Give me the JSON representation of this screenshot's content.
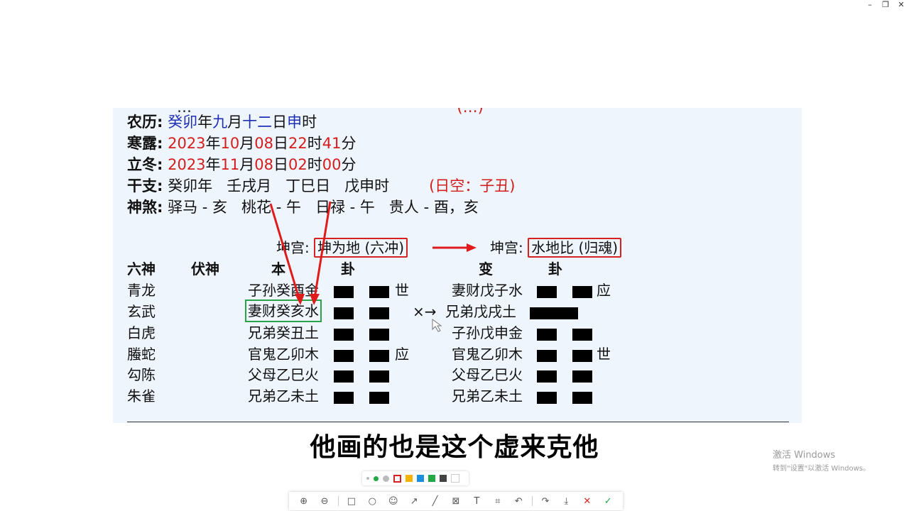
{
  "window": {
    "minimize": "–",
    "restore": "❐",
    "close": "✕"
  },
  "doc": {
    "cut_line": {
      "left": "…",
      "right": "(…)"
    },
    "lunar": {
      "label": "农历:",
      "year": "癸卯",
      "nian": "年",
      "month": "九",
      "yue": "月",
      "day": "十二",
      "ri": "日",
      "hour": "申",
      "shi": "时"
    },
    "hanlu": {
      "label": "寒露:",
      "y": "2023",
      "nian": "年",
      "m": "10",
      "yue": "月",
      "d": "08",
      "ri": "日",
      "h": "22",
      "shi": "时",
      "mi": "41",
      "fen": "分"
    },
    "lidong": {
      "label": "立冬:",
      "y": "2023",
      "nian": "年",
      "m": "11",
      "yue": "月",
      "d": "08",
      "ri": "日",
      "h": "02",
      "shi": "时",
      "mi": "00",
      "fen": "分"
    },
    "ganzhi": {
      "label": "干支:",
      "year": "癸卯年",
      "month": "壬戌月",
      "day": "丁巳日",
      "hour": "戊申时",
      "kong": "(日空：子丑)"
    },
    "shensha": {
      "label": "神煞:",
      "a": "驿马 - 亥",
      "b": "桃花 - 午",
      "c": "日禄 - 午",
      "d": "贵人 - 酉，亥"
    },
    "gong_left": {
      "label": "坤宫:",
      "name": "坤为地 (六冲)"
    },
    "gong_right": {
      "label": "坤宫:",
      "name": "水地比 (归魂)"
    },
    "headers": {
      "liushen": "六神",
      "fushen": "伏神",
      "ben": "本",
      "gua1": "卦",
      "bian": "变",
      "gua2": "卦"
    },
    "rows": [
      {
        "shen": "青龙",
        "ben": "子孙癸酉金",
        "mark": "世",
        "bian": "妻财戊子水",
        "mark2": "应"
      },
      {
        "shen": "玄武",
        "ben": "妻财癸亥水",
        "mark": "×→",
        "bian": "兄弟戊戌土",
        "mark2": ""
      },
      {
        "shen": "白虎",
        "ben": "兄弟癸丑土",
        "mark": "",
        "bian": "子孙戊申金",
        "mark2": ""
      },
      {
        "shen": "螣蛇",
        "ben": "官鬼乙卯木",
        "mark": "应",
        "bian": "官鬼乙卯木",
        "mark2": "世"
      },
      {
        "shen": "勾陈",
        "ben": "父母乙巳火",
        "mark": "",
        "bian": "父母乙巳火",
        "mark2": ""
      },
      {
        "shen": "朱雀",
        "ben": "兄弟乙未土",
        "mark": "",
        "bian": "兄弟乙未土",
        "mark2": ""
      }
    ]
  },
  "subtitle": "他画的也是这个虚来克他",
  "watermark": {
    "line1": "激活 Windows",
    "line2": "转到\"设置\"以激活 Windows。"
  },
  "toolbar": {
    "zoom_in": "⊕",
    "zoom_out": "⊖",
    "rect": "□",
    "circle": "○",
    "emoji": "☺",
    "arrow": "↗",
    "pen": "╱",
    "mosaic": "⊠",
    "text": "T",
    "crop": "⌗",
    "undo": "↶",
    "share": "↷",
    "save": "⤓",
    "cancel": "✕",
    "confirm": "✓"
  },
  "palette_colors": [
    "#d42222",
    "#f5b400",
    "#1a8fe0",
    "#23a846",
    "#444444",
    "#ffffff"
  ]
}
